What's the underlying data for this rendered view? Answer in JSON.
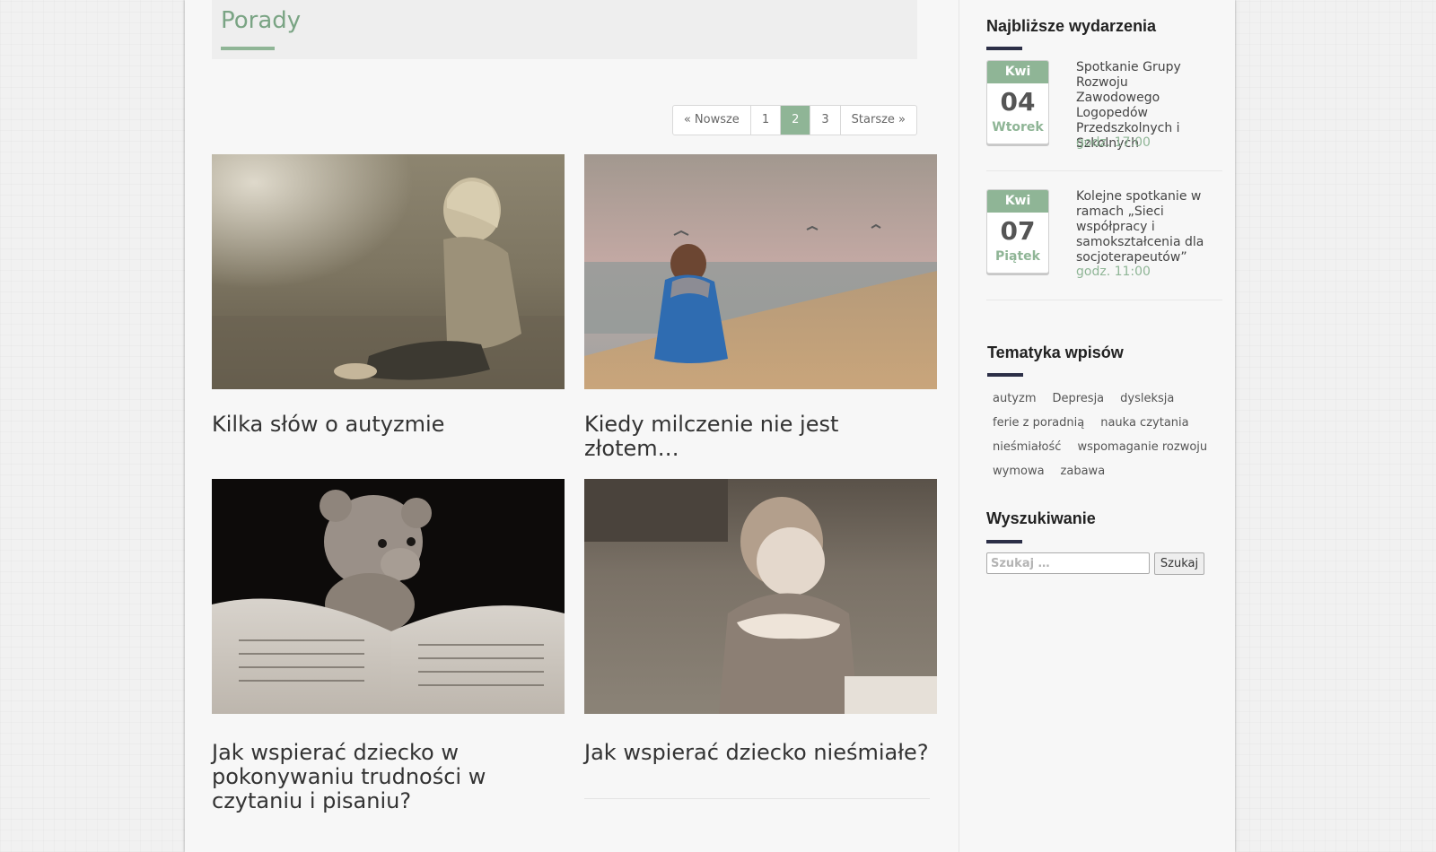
{
  "page": {
    "title": "Porady"
  },
  "pagination": {
    "newer": "« Nowsze",
    "pages": [
      "1",
      "2",
      "3"
    ],
    "current": "2",
    "older": "Starsze »"
  },
  "posts": [
    {
      "title": "Kilka słów o autyzmie",
      "image": "girl-sitting-on-ground-sepia-photo"
    },
    {
      "title": "Kiedy milczenie nie jest złotem…",
      "image": "boy-sitting-on-beach-photo"
    },
    {
      "title": "Jak wspierać dziecko w pokonywaniu trudności w czytaniu i pisaniu?",
      "image": "teddy-bear-with-book-photo"
    },
    {
      "title": "Jak wspierać dziecko nieśmiałe?",
      "image": "shy-girl-sepia-photo"
    }
  ],
  "sidebar": {
    "events_title": "Najbliższe wydarzenia",
    "events": [
      {
        "month": "Kwi",
        "day": "04",
        "weekday": "Wtorek",
        "title": "Spotkanie Grupy Rozwoju Zawodowego Logopedów Przedszkolnych i Szkolnych",
        "time": "godz. 17:00"
      },
      {
        "month": "Kwi",
        "day": "07",
        "weekday": "Piątek",
        "title": "Kolejne spotkanie w ramach „Sieci współpracy i samokształcenia dla socjoterapeutów”",
        "time": "godz. 11:00"
      }
    ],
    "tags_title": "Tematyka wpisów",
    "tags": [
      "autyzm",
      "Depresja",
      "dysleksja",
      "ferie z poradnią",
      "nauka czytania",
      "nieśmiałość",
      "wspomaganie rozwoju",
      "wymowa",
      "zabawa"
    ],
    "search_title": "Wyszukiwanie",
    "search_placeholder": "Szukaj …",
    "search_button": "Szukaj"
  },
  "colors": {
    "accent": "#8fb596",
    "title_green": "#7aa484",
    "widget_bar": "#2c2f47"
  }
}
